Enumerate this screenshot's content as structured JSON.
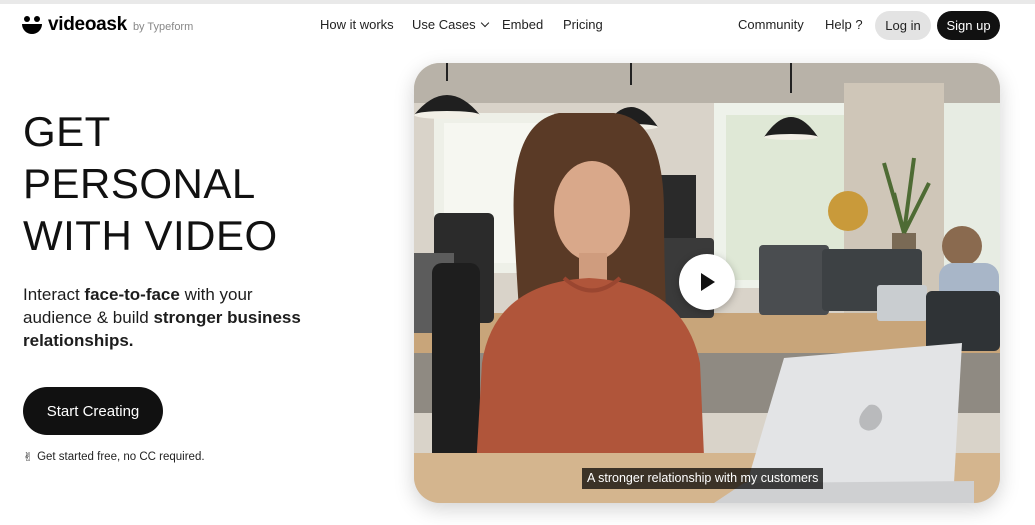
{
  "brand": {
    "name": "videoask",
    "byline": "by Typeform"
  },
  "nav": {
    "how_it_works": "How it works",
    "use_cases": "Use Cases",
    "embed": "Embed",
    "pricing": "Pricing",
    "community": "Community",
    "help": "Help ?",
    "login": "Log in",
    "signup": "Sign up"
  },
  "hero": {
    "headline_lines": [
      "GET",
      "PERSONAL",
      "WITH VIDEO"
    ],
    "subtitle": {
      "p1": "Interact ",
      "b1": "face-to-face",
      "p2": " with your audience & build ",
      "b2": "stronger business relationships."
    },
    "cta_label": "Start Creating",
    "note_icon": "✌",
    "note": "Get started free, no CC required."
  },
  "video": {
    "caption": "A stronger relationship with my customers",
    "play_icon": "play-icon"
  },
  "colors": {
    "dark": "#111111",
    "login_bg": "#e3e3e3",
    "sweater": "#b0553a"
  }
}
